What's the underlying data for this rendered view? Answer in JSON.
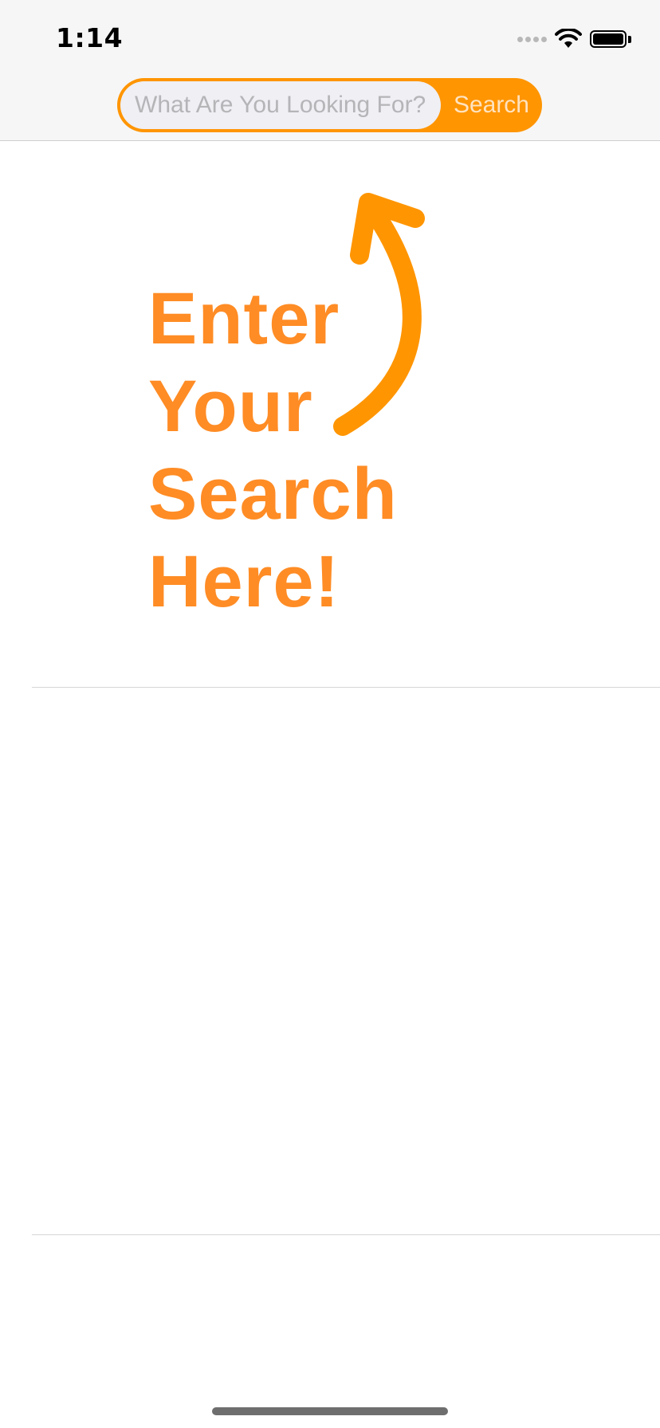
{
  "status_bar": {
    "time": "1:14"
  },
  "search": {
    "placeholder": "What Are You Looking For?",
    "value": "",
    "button_label": "Search"
  },
  "hint": {
    "text": "Enter\nYour\nSearch\nHere!"
  },
  "icons": {
    "signal": "cellular-signal-icon",
    "wifi": "wifi-icon",
    "battery": "battery-icon",
    "arrow": "curved-arrow-up-icon"
  },
  "colors": {
    "accent": "#ff9500",
    "hint_text": "#ff8c25",
    "header_bg": "#f6f6f6"
  }
}
